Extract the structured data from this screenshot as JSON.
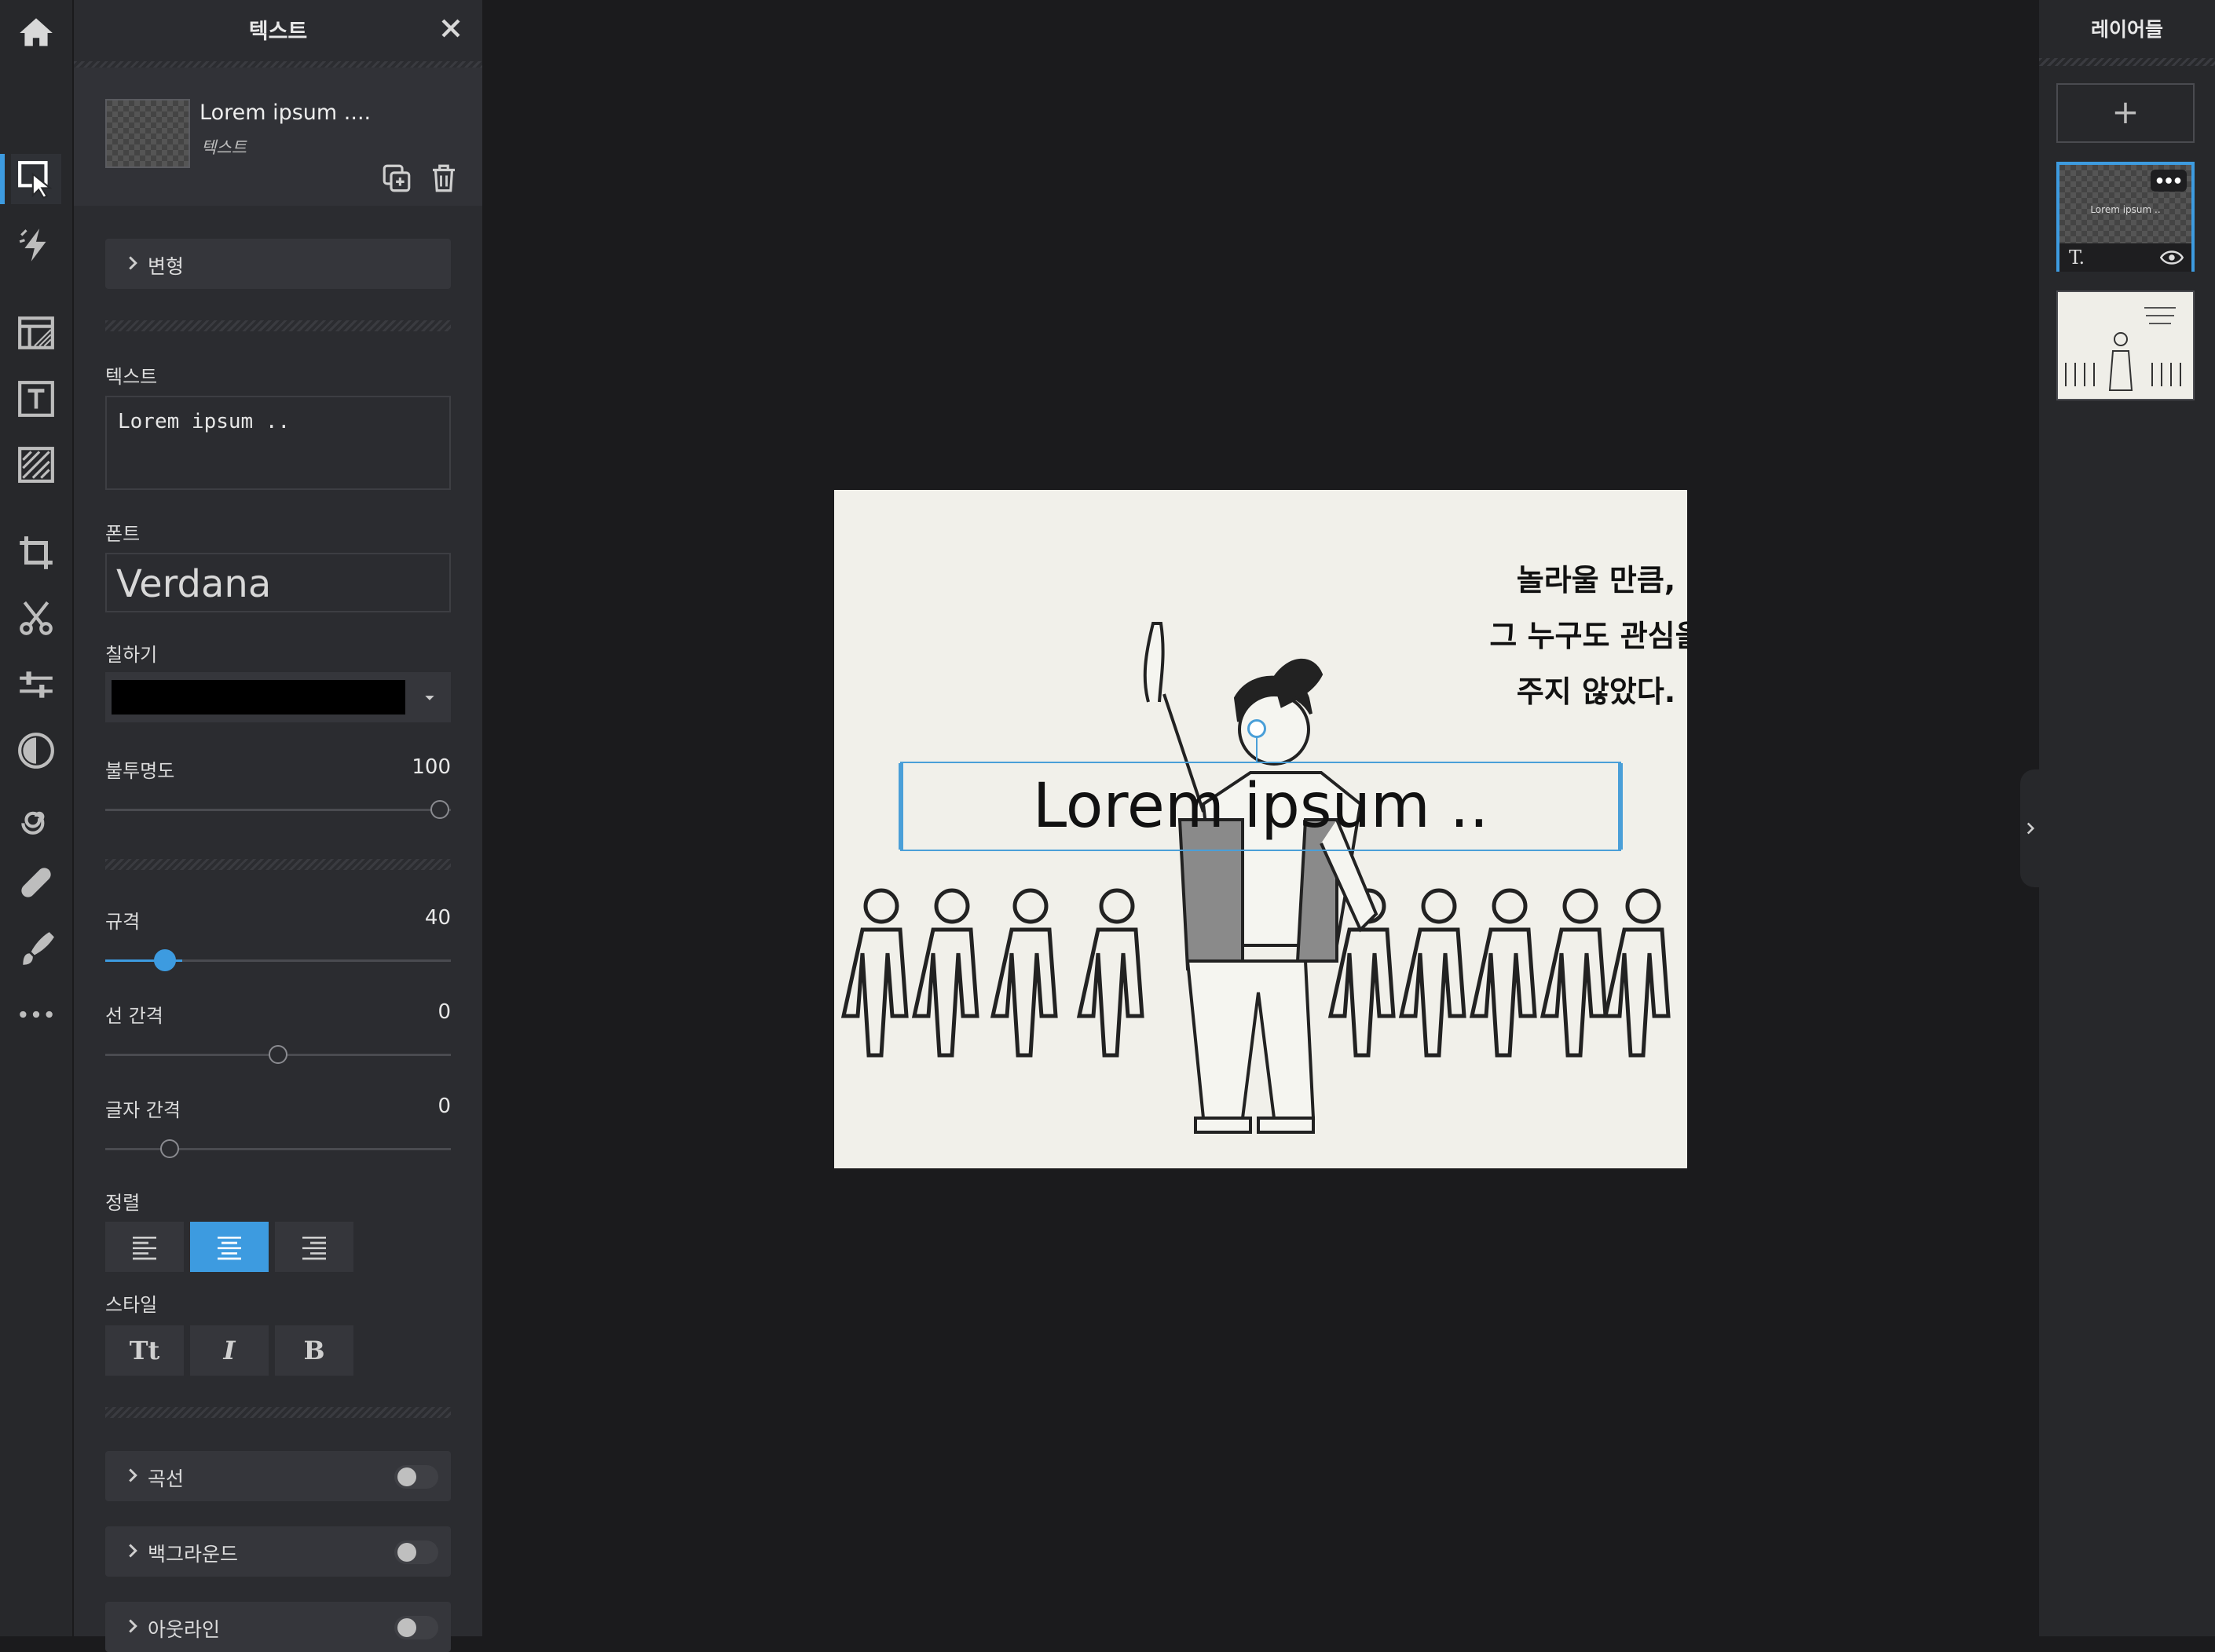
{
  "panel": {
    "title": "텍스트",
    "layer_name": "Lorem ipsum ....",
    "layer_type": "텍스트",
    "transform_label": "변형",
    "text_label": "텍스트",
    "text_value": "Lorem ipsum ..",
    "font_label": "폰트",
    "font_value": "Verdana",
    "fill_label": "칠하기",
    "fill_color": "#000000",
    "opacity_label": "불투명도",
    "opacity_value": "100",
    "size_label": "규격",
    "size_value": "40",
    "line_spacing_label": "선 간격",
    "line_spacing_value": "0",
    "letter_spacing_label": "글자 간격",
    "letter_spacing_value": "0",
    "align_label": "정렬",
    "style_label": "스타일",
    "style_buttons": [
      "Tt",
      "I",
      "B"
    ],
    "curve_label": "곡선",
    "background_label": "백그라운드",
    "outline_label": "아웃라인"
  },
  "canvas": {
    "caption_lines": [
      "놀라울 만큼,",
      "그 누구도 관심을",
      "주지 않았다."
    ],
    "overlay_text": "Lorem ipsum .."
  },
  "layers": {
    "title": "레이어들",
    "add_label": "+",
    "layer1_thumb_text": "Lorem ipsum ..",
    "layer1_type_glyph": "T."
  },
  "colors": {
    "accent": "#3d9be0",
    "panel_bg": "#2b2c30",
    "toolbar_bg": "#27282b",
    "workspace_bg": "#1b1b1d"
  }
}
